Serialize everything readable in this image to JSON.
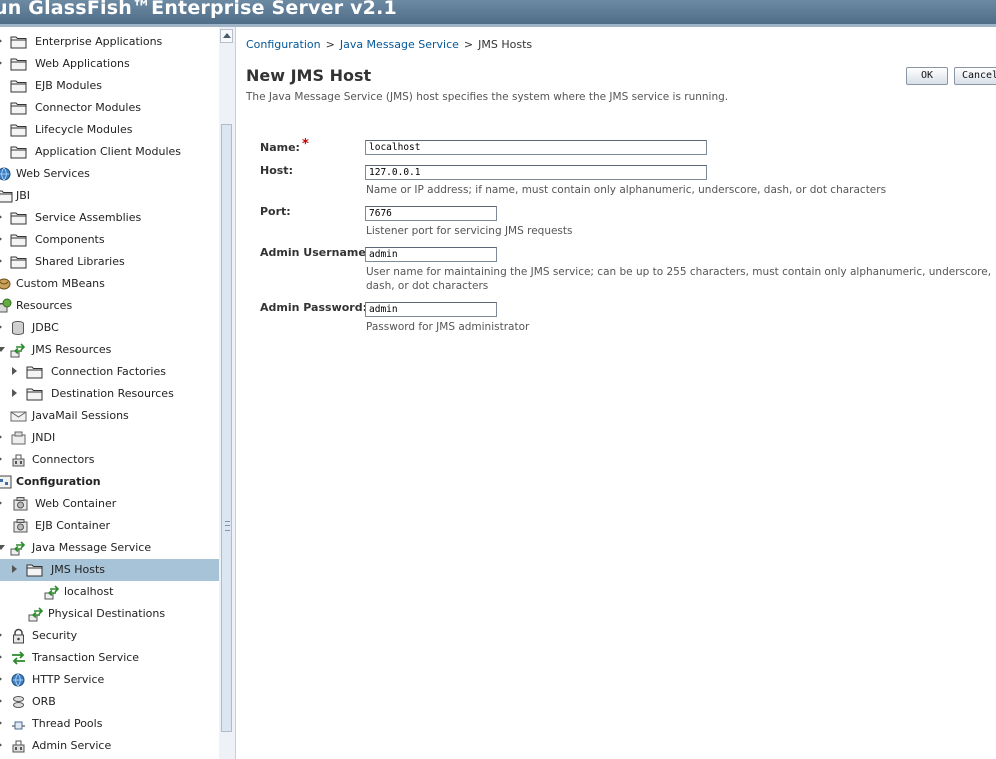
{
  "header": {
    "title": "un GlassFish™Enterprise Server v2.1"
  },
  "tree": {
    "items": [
      {
        "label": "Enterprise Applications",
        "icon": "folder-icon"
      },
      {
        "label": "Web Applications",
        "icon": "folder-icon"
      },
      {
        "label": "EJB Modules",
        "icon": "folder-icon"
      },
      {
        "label": "Connector Modules",
        "icon": "folder-icon"
      },
      {
        "label": "Lifecycle Modules",
        "icon": "folder-icon"
      },
      {
        "label": "Application Client Modules",
        "icon": "folder-icon"
      },
      {
        "label": "Web Services",
        "icon": "globe-icon"
      },
      {
        "label": "JBI",
        "icon": "folder-icon"
      },
      {
        "label": "Service Assemblies",
        "icon": "folder-icon"
      },
      {
        "label": "Components",
        "icon": "folder-icon"
      },
      {
        "label": "Shared Libraries",
        "icon": "folder-icon"
      },
      {
        "label": "Custom MBeans",
        "icon": "bean-icon"
      },
      {
        "label": "Resources",
        "icon": "resources-icon"
      },
      {
        "label": "JDBC",
        "icon": "database-icon"
      },
      {
        "label": "JMS Resources",
        "icon": "jms-arrows-icon"
      },
      {
        "label": "Connection Factories",
        "icon": "folder-icon"
      },
      {
        "label": "Destination Resources",
        "icon": "folder-icon"
      },
      {
        "label": "JavaMail Sessions",
        "icon": "mail-icon"
      },
      {
        "label": "JNDI",
        "icon": "jndi-icon"
      },
      {
        "label": "Connectors",
        "icon": "connector-icon"
      },
      {
        "label": "Configuration",
        "icon": "configuration-icon"
      },
      {
        "label": "Web Container",
        "icon": "container-icon"
      },
      {
        "label": "EJB Container",
        "icon": "container-icon"
      },
      {
        "label": "Java Message Service",
        "icon": "jms-arrows-icon"
      },
      {
        "label": "JMS Hosts",
        "icon": "folder-icon"
      },
      {
        "label": "localhost",
        "icon": "jms-arrows-icon"
      },
      {
        "label": "Physical Destinations",
        "icon": "jms-arrows-icon"
      },
      {
        "label": "Security",
        "icon": "lock-icon"
      },
      {
        "label": "Transaction Service",
        "icon": "transaction-icon"
      },
      {
        "label": "HTTP Service",
        "icon": "globe-icon"
      },
      {
        "label": "ORB",
        "icon": "orb-icon"
      },
      {
        "label": "Thread Pools",
        "icon": "thread-icon"
      },
      {
        "label": "Admin Service",
        "icon": "connector-icon"
      }
    ]
  },
  "breadcrumb": {
    "configuration": "Configuration",
    "sep": ">",
    "jms_service": "Java Message Service",
    "current": "JMS Hosts"
  },
  "page": {
    "title": "New JMS Host",
    "help": "The Java Message Service (JMS) host specifies the system where the JMS service is running.",
    "ok_label": "OK",
    "cancel_label": "Cancel"
  },
  "form": {
    "name_label": "Name:",
    "required_mark": "*",
    "name_value": "localhost",
    "host_label": "Host:",
    "host_value": "127.0.0.1",
    "host_help": "Name or IP address; if name, must contain only alphanumeric, underscore, dash, or dot characters",
    "port_label": "Port:",
    "port_value": "7676",
    "port_help": "Listener port for servicing JMS requests",
    "user_label": "Admin Username:",
    "user_value": "admin",
    "user_help": "User name for maintaining the JMS service; can be up to 255 characters, must contain only alphanumeric, underscore, dash, or dot characters",
    "pass_label": "Admin Password:",
    "pass_value": "admin",
    "pass_help": "Password for JMS administrator"
  },
  "colors": {
    "header_bg": "#5a7894",
    "selection": "#a7c3d8",
    "link": "#035899",
    "required": "#cc0000"
  }
}
